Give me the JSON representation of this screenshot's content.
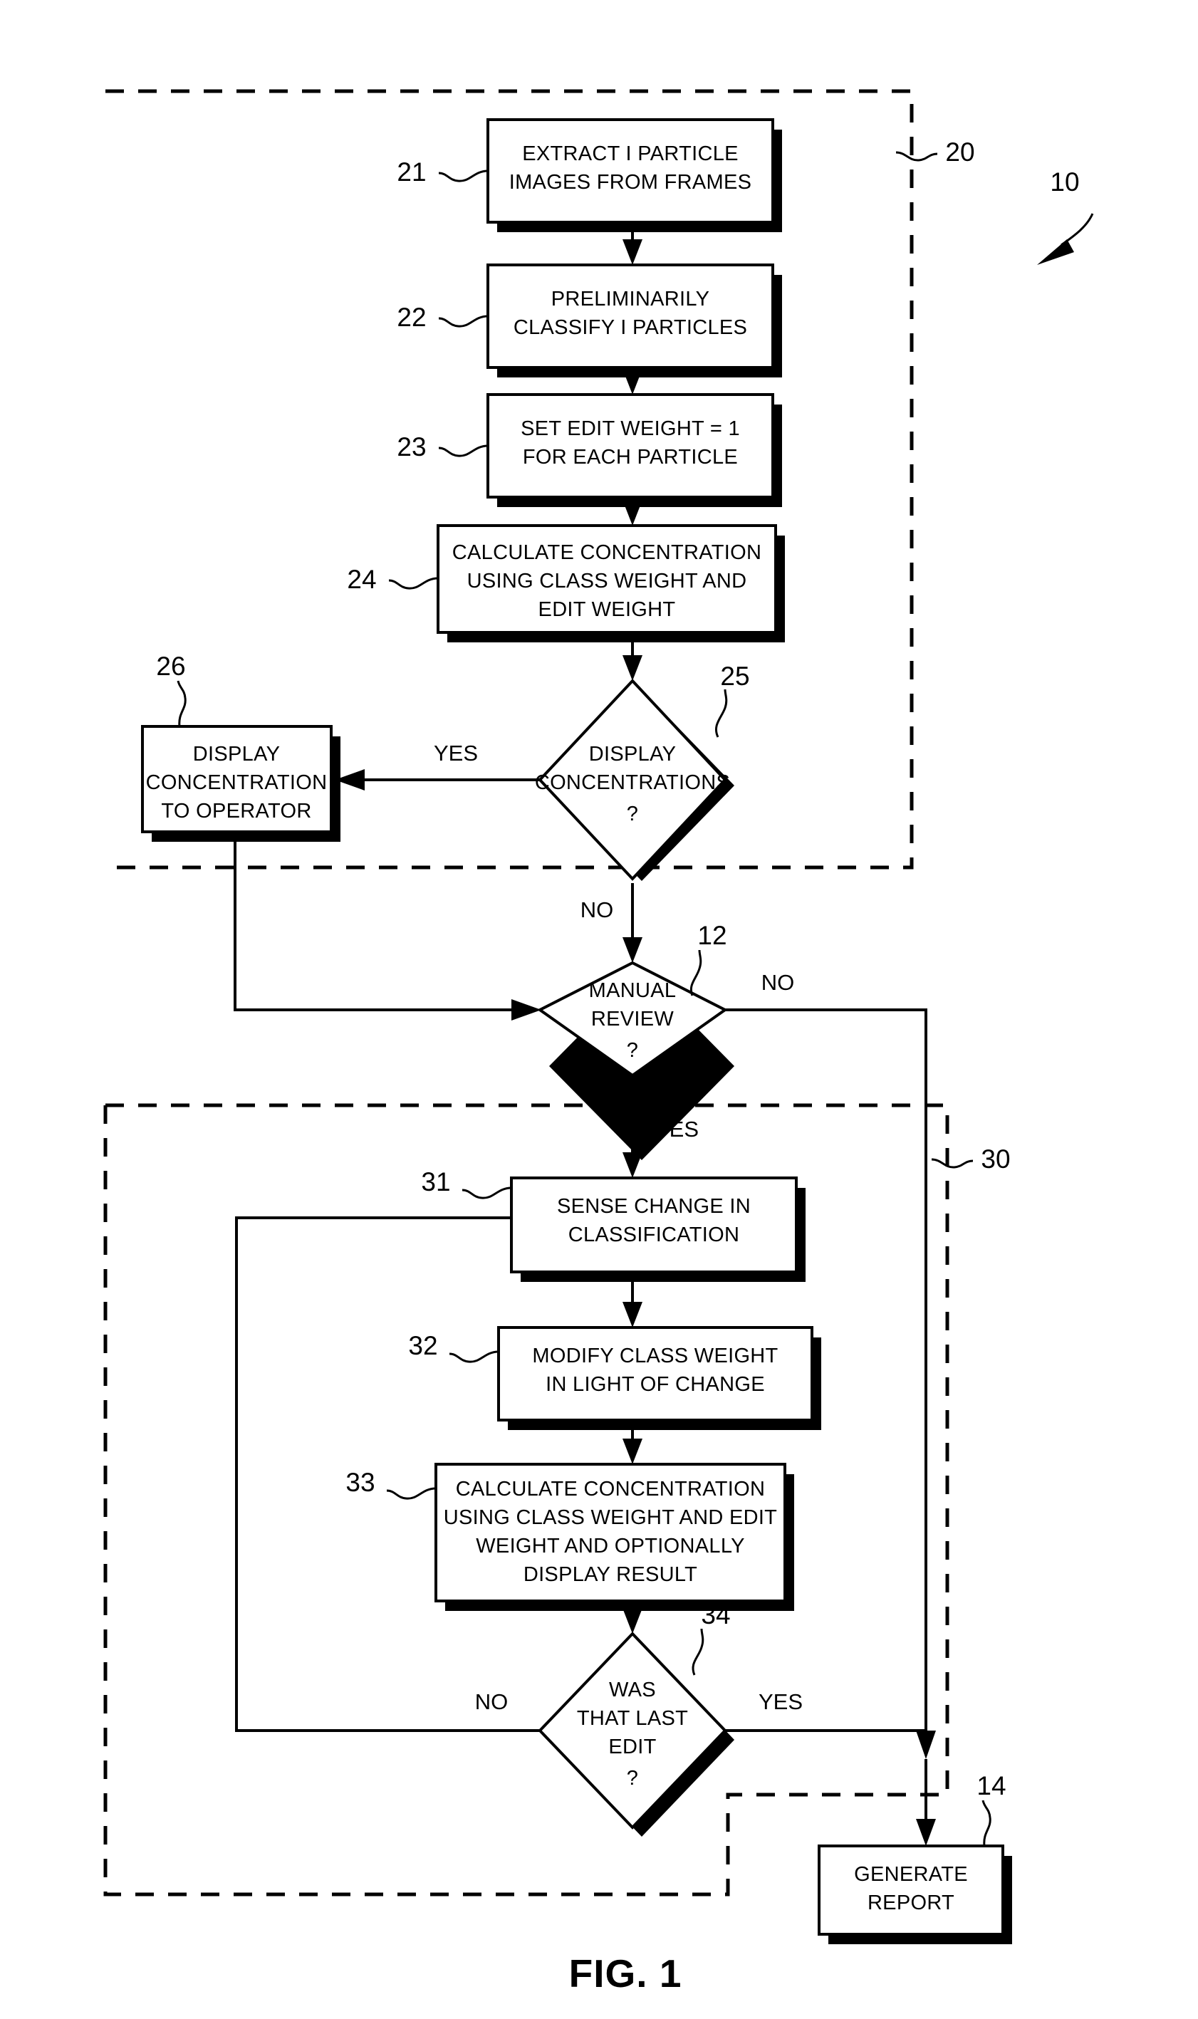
{
  "figure": {
    "caption": "FIG. 1",
    "overall_ref": "10"
  },
  "groups": [
    {
      "id": "group-20",
      "ref": "20"
    },
    {
      "id": "group-30",
      "ref": "30"
    }
  ],
  "nodes": [
    {
      "id": "n21",
      "ref": "21",
      "type": "process",
      "lines": [
        "EXTRACT I PARTICLE",
        "IMAGES FROM FRAMES"
      ]
    },
    {
      "id": "n22",
      "ref": "22",
      "type": "process",
      "lines": [
        "PRELIMINARILY",
        "CLASSIFY I PARTICLES"
      ]
    },
    {
      "id": "n23",
      "ref": "23",
      "type": "process",
      "lines": [
        "SET EDIT WEIGHT = 1",
        "FOR EACH PARTICLE"
      ]
    },
    {
      "id": "n24",
      "ref": "24",
      "type": "process",
      "lines": [
        "CALCULATE CONCENTRATION",
        "USING CLASS WEIGHT AND",
        "EDIT WEIGHT"
      ]
    },
    {
      "id": "n25",
      "ref": "25",
      "type": "decision",
      "lines": [
        "DISPLAY",
        "CONCENTRATIONS",
        "?"
      ]
    },
    {
      "id": "n26",
      "ref": "26",
      "type": "process",
      "lines": [
        "DISPLAY",
        "CONCENTRATION",
        "TO OPERATOR"
      ]
    },
    {
      "id": "n12",
      "ref": "12",
      "type": "decision",
      "lines": [
        "MANUAL",
        "REVIEW",
        "?"
      ]
    },
    {
      "id": "n31",
      "ref": "31",
      "type": "process",
      "lines": [
        "SENSE CHANGE IN",
        "CLASSIFICATION"
      ]
    },
    {
      "id": "n32",
      "ref": "32",
      "type": "process",
      "lines": [
        "MODIFY CLASS WEIGHT",
        "IN LIGHT OF CHANGE"
      ]
    },
    {
      "id": "n33",
      "ref": "33",
      "type": "process",
      "lines": [
        "CALCULATE CONCENTRATION",
        "USING CLASS WEIGHT AND EDIT",
        "WEIGHT AND OPTIONALLY",
        "DISPLAY RESULT"
      ]
    },
    {
      "id": "n34",
      "ref": "34",
      "type": "decision",
      "lines": [
        "WAS",
        "THAT LAST",
        "EDIT",
        "?"
      ]
    },
    {
      "id": "n14",
      "ref": "14",
      "type": "process",
      "lines": [
        "GENERATE",
        "REPORT"
      ]
    }
  ],
  "edge_labels": {
    "d25_yes": "YES",
    "d25_no": "NO",
    "d12_no": "NO",
    "d12_yes": "YES",
    "d34_no": "NO",
    "d34_yes": "YES"
  },
  "colors": {
    "ink": "#000000",
    "paper": "#ffffff"
  }
}
